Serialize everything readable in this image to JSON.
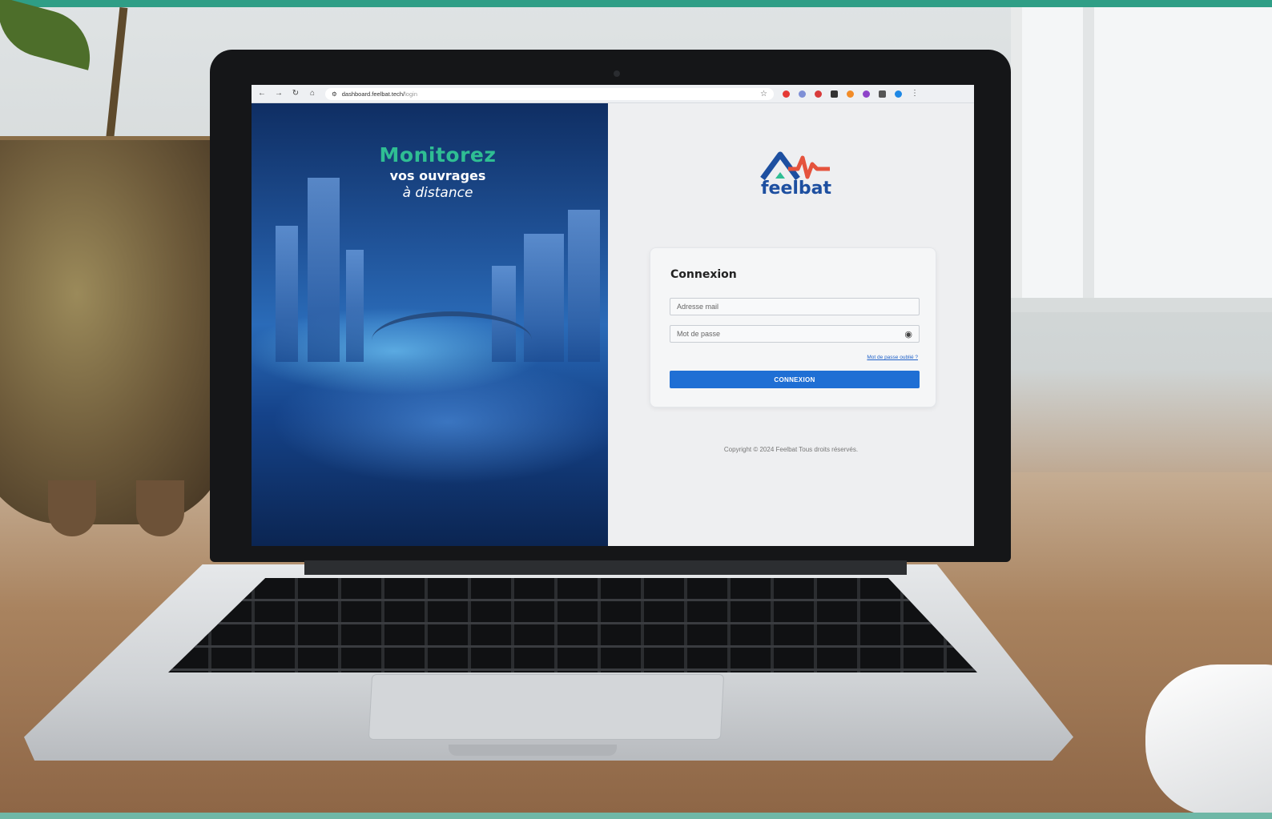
{
  "browser": {
    "url_host": "dashboard.feelbat.tech/",
    "url_path": "login",
    "icons": [
      "back-icon",
      "forward-icon",
      "reload-icon",
      "home-icon",
      "site-info-icon",
      "bookmark-star-icon",
      "menu-icon"
    ],
    "extension_colors": [
      "#e53935",
      "#7e8fd6",
      "#d83b3b",
      "#333333",
      "#f28c28",
      "#8e44c9",
      "#555555",
      "#1e88e5"
    ]
  },
  "hero": {
    "line1": "Monitorez",
    "line2": "vos ouvrages",
    "line3": "à distance"
  },
  "brand": {
    "name": "feelbat",
    "colors": {
      "blue": "#1d4fa0",
      "green": "#2fbe93",
      "red": "#e5533d"
    }
  },
  "login": {
    "title": "Connexion",
    "email_placeholder": "Adresse mail",
    "password_placeholder": "Mot de passe",
    "forgot_link": "Mot de passe oublié ?",
    "submit_label": "CONNEXION"
  },
  "footer": {
    "copyright": "Copyright © 2024 Feelbat Tous droits réservés."
  },
  "accent_colors": {
    "stripe": "#2f9e86",
    "button": "#1f6fd4"
  }
}
